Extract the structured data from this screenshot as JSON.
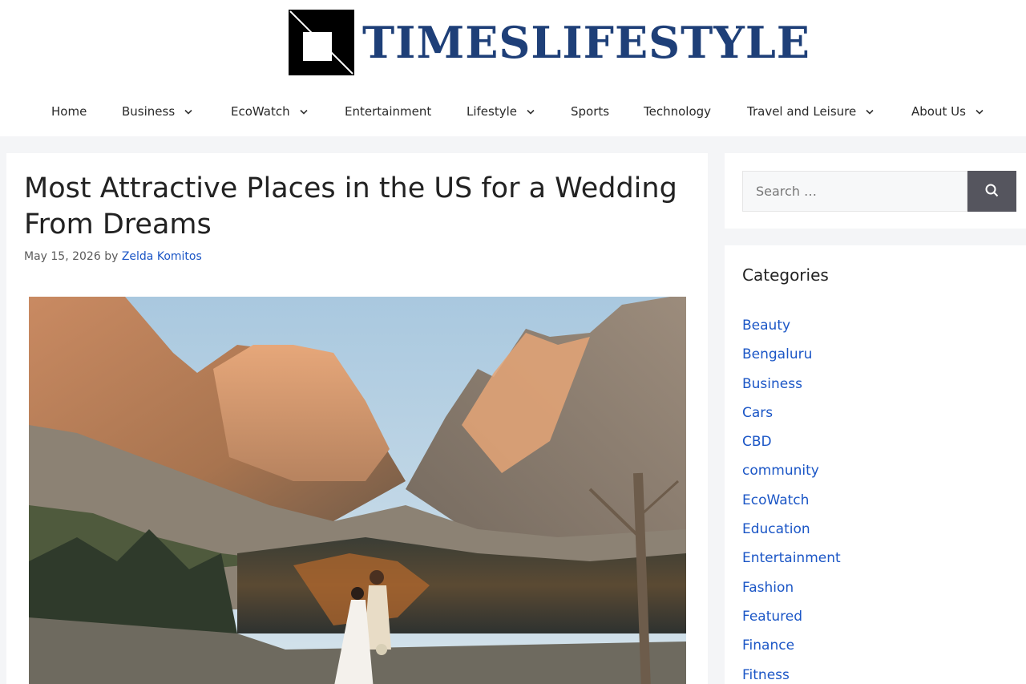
{
  "site": {
    "brand_name": "TIMESLIFESTYLE",
    "brand_color": "#1e3f78"
  },
  "nav": {
    "items": [
      {
        "label": "Home",
        "dropdown": false
      },
      {
        "label": "Business",
        "dropdown": true
      },
      {
        "label": "EcoWatch",
        "dropdown": true
      },
      {
        "label": "Entertainment",
        "dropdown": false
      },
      {
        "label": "Lifestyle",
        "dropdown": true
      },
      {
        "label": "Sports",
        "dropdown": false
      },
      {
        "label": "Technology",
        "dropdown": false
      },
      {
        "label": "Travel and Leisure",
        "dropdown": true
      },
      {
        "label": "About Us",
        "dropdown": true
      }
    ]
  },
  "article": {
    "title": "Most Attractive Places in the US for a Wedding From Dreams",
    "date": "May 15, 2026",
    "by": "by",
    "author": "Zelda Komitos"
  },
  "search": {
    "placeholder": "Search …",
    "button_icon": "search-icon"
  },
  "categories": {
    "title": "Categories",
    "items": [
      "Beauty",
      "Bengaluru",
      "Business",
      "Cars",
      "CBD",
      "community",
      "EcoWatch",
      "Education",
      "Entertainment",
      "Fashion",
      "Featured",
      "Finance",
      "Fitness"
    ]
  },
  "colors": {
    "link": "#1b56c6",
    "search_button": "#55555e",
    "page_background": "#f4f5f7"
  }
}
